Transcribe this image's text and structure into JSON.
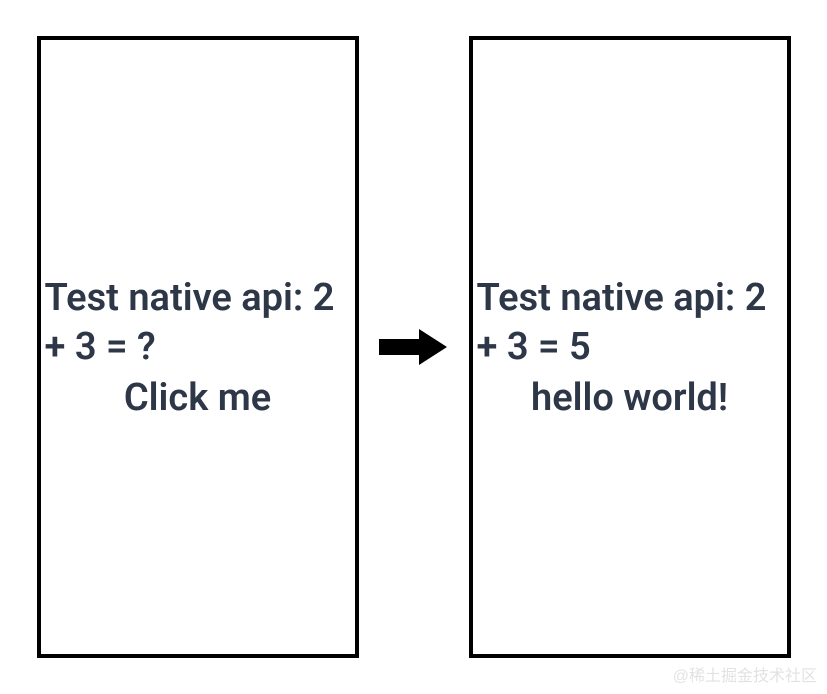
{
  "left_panel": {
    "text_line1": "Test native api: 2",
    "text_line2": "+ 3 = ?",
    "button_label": "Click me"
  },
  "right_panel": {
    "text_line1": "Test native api: 2",
    "text_line2": "+ 3 = 5",
    "button_label": "hello world!"
  },
  "watermark": "@稀土掘金技术社区"
}
